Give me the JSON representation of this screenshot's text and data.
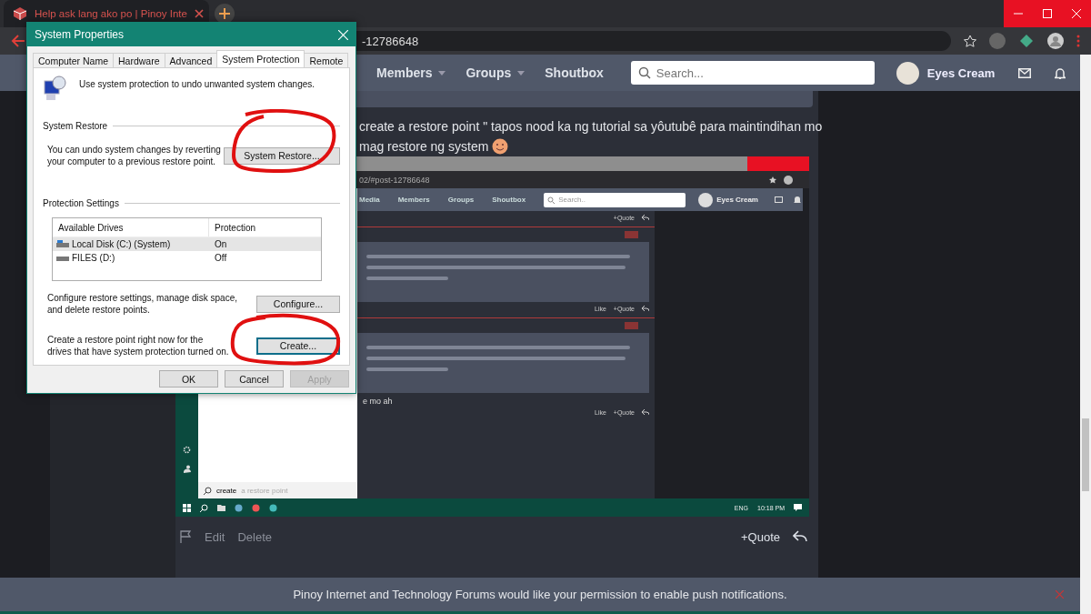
{
  "browser": {
    "tab_title": "Help ask lang ako po | Pinoy Inte",
    "url": "-12786648"
  },
  "forum": {
    "nav": [
      "Members",
      "Groups",
      "Shoutbox"
    ],
    "nav_dropdown": [
      true,
      true,
      false
    ],
    "search_placeholder": "Search...",
    "user": "Eyes Cream",
    "post_lines": [
      "create a restore point \" tapos nood ka ng tutorial sa yôutubê para maintindihan mo",
      "mag restore ng system"
    ],
    "post_actions": [
      "Edit",
      "Delete"
    ],
    "quote": "+Quote",
    "notification": "Pinoy Internet and Technology Forums would like your permission to enable push notifications."
  },
  "embedded_screenshot": {
    "url": "02/#post-12786648",
    "nav": [
      "Media",
      "Members",
      "Groups",
      "Shoutbox"
    ],
    "search_placeholder": "Search..",
    "user": "Eyes Cream",
    "posts": [
      {
        "badge": false,
        "quote_box": false,
        "actions": [
          "+Quote"
        ]
      },
      {
        "badge": true,
        "quote_box": true,
        "actions": [
          "Like",
          "+Quote"
        ]
      },
      {
        "badge": true,
        "quote_box": true,
        "text": "e mo ah",
        "actions": [
          "Like",
          "+Quote"
        ]
      }
    ],
    "start_search": {
      "value": "create",
      "suggestion": "a restore point"
    },
    "taskbar": {
      "language": "ENG",
      "time": "10:18 PM"
    }
  },
  "dialog": {
    "title": "System Properties",
    "tabs": [
      {
        "label": "Computer Name",
        "selected": false
      },
      {
        "label": "Hardware",
        "selected": false
      },
      {
        "label": "Advanced",
        "selected": false
      },
      {
        "label": "System Protection",
        "selected": true
      },
      {
        "label": "Remote",
        "selected": false
      }
    ],
    "intro": "Use system protection to undo unwanted system changes.",
    "restore_heading": "System Restore",
    "restore_text": "You can undo system changes by reverting your computer to a previous restore point.",
    "restore_button": "System Restore...",
    "settings_heading": "Protection Settings",
    "columns": [
      "Available Drives",
      "Protection"
    ],
    "drives": [
      {
        "name": "Local Disk (C:) (System)",
        "protection": "On",
        "selected": true
      },
      {
        "name": "FILES (D:)",
        "protection": "Off",
        "selected": false
      }
    ],
    "configure_text": "Configure restore settings, manage disk space, and delete restore points.",
    "configure_button": "Configure...",
    "create_text": "Create a restore point right now for the drives that have system protection turned on.",
    "create_button": "Create...",
    "buttons": [
      {
        "label": "OK",
        "disabled": false
      },
      {
        "label": "Cancel",
        "disabled": false
      },
      {
        "label": "Apply",
        "disabled": true
      }
    ]
  }
}
